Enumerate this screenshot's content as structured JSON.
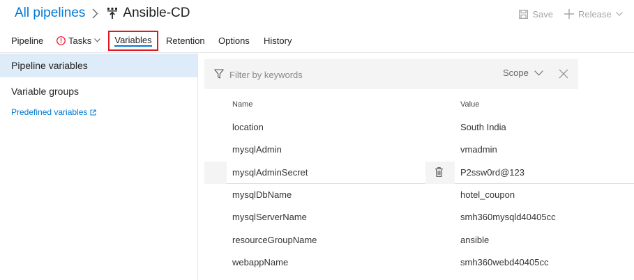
{
  "breadcrumb": {
    "parent": "All pipelines",
    "separator_icon": "chevron-right-icon",
    "pipeline_icon": "release-pipeline-icon",
    "title": "Ansible-CD"
  },
  "header_actions": {
    "save_label": "Save",
    "save_icon": "save-icon",
    "release_label": "Release",
    "release_icon": "plus-icon"
  },
  "tabs": [
    {
      "label": "Pipeline"
    },
    {
      "label": "Tasks",
      "icon": "warning-icon"
    },
    {
      "label": "Variables",
      "active": true
    },
    {
      "label": "Retention"
    },
    {
      "label": "Options"
    },
    {
      "label": "History"
    }
  ],
  "leftnav": {
    "pipeline_variables": "Pipeline variables",
    "variable_groups": "Variable groups",
    "predefined_variables": "Predefined variables"
  },
  "filter": {
    "placeholder": "Filter by keywords",
    "value": "",
    "scope_label": "Scope"
  },
  "table": {
    "headers": {
      "name": "Name",
      "value": "Value"
    },
    "rows": [
      {
        "name": "location",
        "value": "South India"
      },
      {
        "name": "mysqlAdmin",
        "value": "vmadmin"
      },
      {
        "name": "mysqlAdminSecret",
        "value": "P2ssw0rd@123"
      },
      {
        "name": "mysqlDbName",
        "value": "hotel_coupon"
      },
      {
        "name": "mysqlServerName",
        "value": "smh360mysqld40405cc"
      },
      {
        "name": "resourceGroupName",
        "value": "ansible"
      },
      {
        "name": "webappName",
        "value": "smh360webd40405cc"
      }
    ]
  },
  "colors": {
    "accent": "#0078d4",
    "highlight_box": "#e0191f",
    "nav_active_bg": "#deecf9",
    "warning": "#e81123"
  }
}
